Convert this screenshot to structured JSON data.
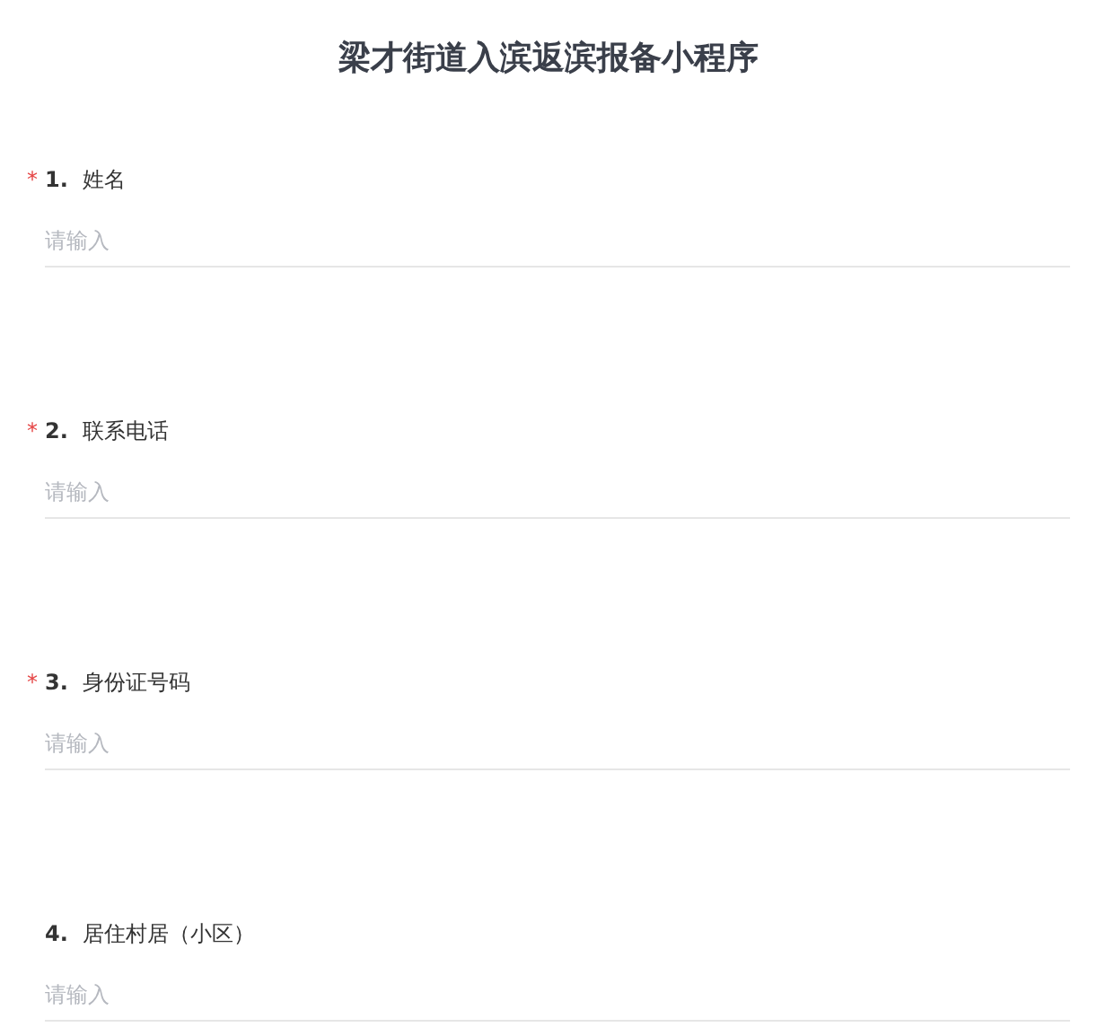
{
  "title": "梁才街道入滨返滨报备小程序",
  "questions": [
    {
      "required_mark": "*",
      "number": "1.",
      "label": "姓名",
      "placeholder": "请输入"
    },
    {
      "required_mark": "*",
      "number": "2.",
      "label": "联系电话",
      "placeholder": "请输入"
    },
    {
      "required_mark": "*",
      "number": "3.",
      "label": "身份证号码",
      "placeholder": "请输入"
    },
    {
      "number": "4.",
      "label": "居住村居（小区）",
      "placeholder": "请输入"
    }
  ]
}
